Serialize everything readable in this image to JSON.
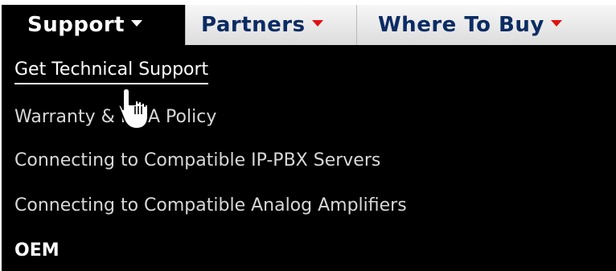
{
  "nav": {
    "tabs": [
      {
        "label": "Support",
        "active": true
      },
      {
        "label": "Partners",
        "active": false
      },
      {
        "label": "Where To Buy",
        "active": false
      }
    ]
  },
  "dropdown": {
    "items": [
      {
        "label": "Get Technical Support",
        "hovered": true
      },
      {
        "label": "Warranty & RMA Policy"
      },
      {
        "label": "Connecting to Compatible IP-PBX Servers"
      },
      {
        "label": "Connecting to Compatible Analog Amplifiers"
      },
      {
        "label": "OEM"
      }
    ]
  },
  "colors": {
    "active_tab_bg": "#000000",
    "inactive_tab_text": "#0b2c63",
    "caret_red": "#e01010",
    "menu_bg": "#000000",
    "menu_text": "#d8d8d8"
  },
  "icons": {
    "cursor": "hand-pointer-icon",
    "caret": "caret-down-icon"
  }
}
